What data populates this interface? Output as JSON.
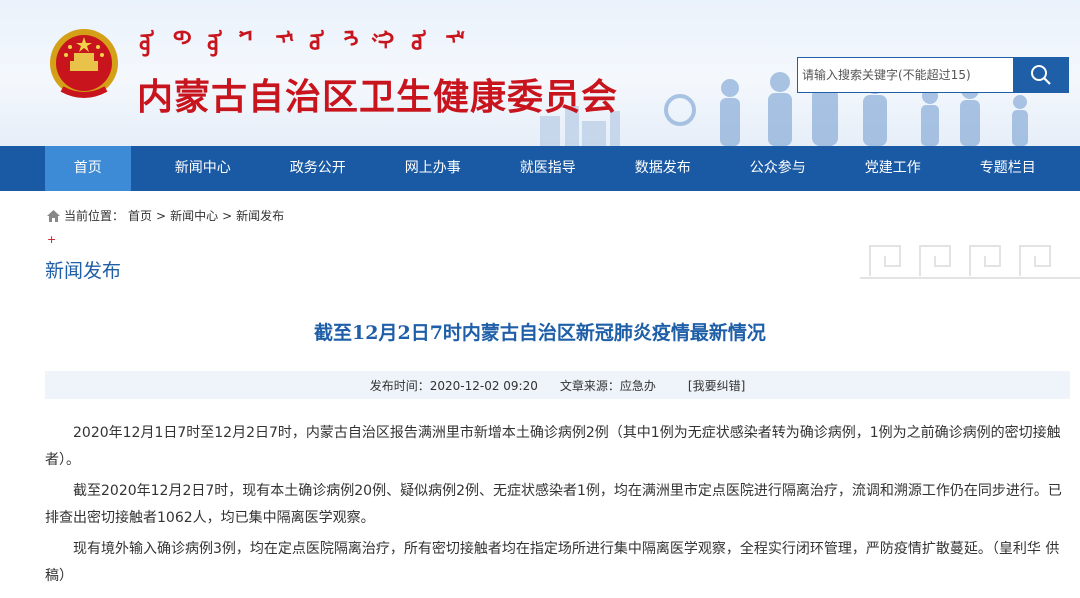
{
  "header": {
    "mongolian_script": [
      "ᠥ",
      "ᠪ",
      "ᠥ",
      "ᠷ",
      "ᠮ",
      "ᠣ",
      "ᠩ",
      "ᠭ",
      "ᠣ",
      "ᠯ"
    ],
    "title": "内蒙古自治区卫生健康委员会",
    "search_placeholder": "请输入搜索关键字(不能超过15)",
    "search_icon": "search-icon",
    "accent": "#c8141c",
    "brand": "#1a5aa5"
  },
  "nav": {
    "items": [
      "首页",
      "新闻中心",
      "政务公开",
      "网上办事",
      "就医指导",
      "数据发布",
      "公众参与",
      "党建工作",
      "专题栏目"
    ],
    "active": "首页"
  },
  "breadcrumb": {
    "icon": "home-icon",
    "label": "当前位置：",
    "path": [
      "首页",
      "新闻中心",
      "新闻发布"
    ],
    "separator": ">"
  },
  "section": {
    "plus": "+",
    "title": "新闻发布"
  },
  "article": {
    "title": "截至12月2日7时内蒙古自治区新冠肺炎疫情最新情况",
    "publish_label": "发布时间：",
    "publish_time": "2020-12-02 09:20",
    "source_label": "文章来源：",
    "source": "应急办",
    "fix_link": "[我要纠错]",
    "paragraphs": [
      "2020年12月1日7时至12月2日7时，内蒙古自治区报告满洲里市新增本土确诊病例2例（其中1例为无症状感染者转为确诊病例，1例为之前确诊病例的密切接触者）。",
      "截至2020年12月2日7时，现有本土确诊病例20例、疑似病例2例、无症状感染者1例，均在满洲里市定点医院进行隔离治疗，流调和溯源工作仍在同步进行。已排查出密切接触者1062人，均已集中隔离医学观察。",
      "现有境外输入确诊病例3例，均在定点医院隔离治疗，所有密切接触者均在指定场所进行集中隔离医学观察，全程实行闭环管理，严防疫情扩散蔓延。（皇利华 供稿）"
    ]
  }
}
